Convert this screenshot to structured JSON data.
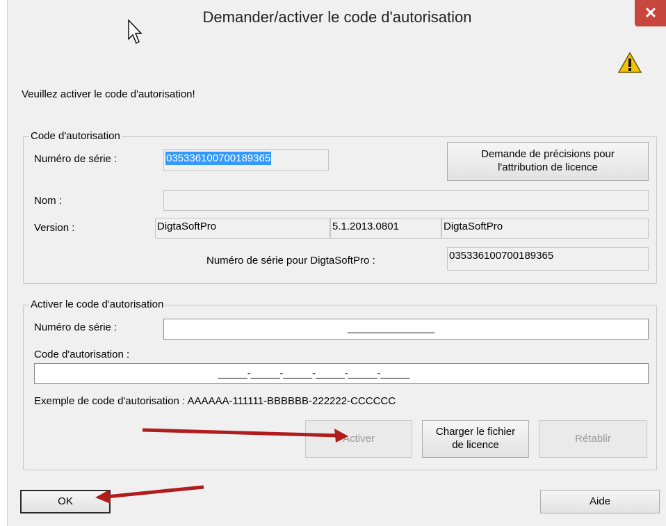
{
  "window": {
    "title": "Demander/activer le code d'autorisation",
    "close_glyph": "✕"
  },
  "prompt": "Veuillez activer le code d'autorisation!",
  "group1": {
    "legend": "Code d'autorisation",
    "serial_label": "Numéro de série :",
    "serial_value": "035336100700189365",
    "request_button": "Demande de précisions pour l'attribution de licence",
    "name_label": "Nom :",
    "name_value": "",
    "version_label": "Version :",
    "version_values": [
      "DigtaSoftPro",
      "5.1.2013.0801",
      "DigtaSoftPro"
    ],
    "serial_for_label": "Numéro de série pour DigtaSoftPro :",
    "serial_for_value": "035336100700189365"
  },
  "group2": {
    "legend": "Activer le code d'autorisation",
    "serial_label": "Numéro de série :",
    "serial_mask": "_______________",
    "code_label": "Code d'autorisation :",
    "code_mask": "_____-_____-_____-_____-_____-_____",
    "example": "Exemple de code d'autorisation : AAAAAA-111111-BBBBBB-222222-CCCCCC",
    "activate_button": "Activer",
    "load_license_button": "Charger le fichier de licence",
    "reset_button": "Rétablir"
  },
  "footer": {
    "ok_button": "OK",
    "help_button": "Aide"
  },
  "colors": {
    "annotation_arrow": "#b01c1c",
    "selection": "#3399ff",
    "close": "#c7463d"
  },
  "icons": {
    "warning": "warning-icon",
    "cursor": "mouse-pointer-icon"
  }
}
